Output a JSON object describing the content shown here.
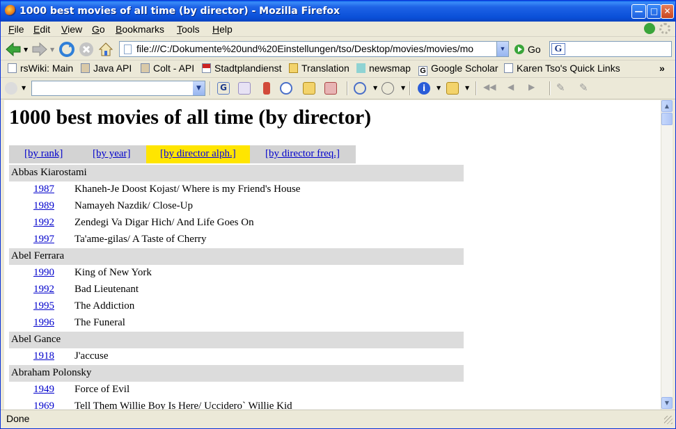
{
  "window": {
    "title": "1000 best movies of all time (by director) - Mozilla Firefox"
  },
  "menu": [
    {
      "label": "File",
      "key": "F",
      "rest": "ile"
    },
    {
      "label": "Edit",
      "key": "E",
      "rest": "dit"
    },
    {
      "label": "View",
      "key": "V",
      "rest": "iew"
    },
    {
      "label": "Go",
      "key": "G",
      "rest": "o"
    },
    {
      "label": "Bookmarks",
      "key": "B",
      "rest": "ookmarks"
    },
    {
      "label": "Tools",
      "key": "T",
      "rest": "ools"
    },
    {
      "label": "Help",
      "key": "H",
      "rest": "elp"
    }
  ],
  "nav": {
    "url": "file:///C:/Dokumente%20und%20Einstellungen/tso/Desktop/movies/movies/mo",
    "go_label": "Go"
  },
  "bookmarks": [
    {
      "label": "rsWiki: Main"
    },
    {
      "label": "Java API"
    },
    {
      "label": "Colt - API"
    },
    {
      "label": "Stadtplandienst"
    },
    {
      "label": "Translation"
    },
    {
      "label": "newsmap"
    },
    {
      "label": "Google Scholar"
    },
    {
      "label": "Karen Tso's Quick Links"
    }
  ],
  "bookmarks_more": "»",
  "page": {
    "heading": "1000 best movies of all time (by director)",
    "tabs": [
      {
        "label": "[by rank]"
      },
      {
        "label": "[by year]"
      },
      {
        "label": "[by director alph.]"
      },
      {
        "label": "[by director freq.]"
      }
    ]
  },
  "directors": [
    {
      "name": "Abbas Kiarostami",
      "films": [
        {
          "year": "1987",
          "title": "Khaneh-Je Doost Kojast/ Where is my Friend's House"
        },
        {
          "year": "1989",
          "title": "Namayeh Nazdik/ Close-Up"
        },
        {
          "year": "1992",
          "title": "Zendegi Va Digar Hich/ And Life Goes On"
        },
        {
          "year": "1997",
          "title": "Ta'ame-gilas/ A Taste of Cherry"
        }
      ]
    },
    {
      "name": "Abel Ferrara",
      "films": [
        {
          "year": "1990",
          "title": "King of New York"
        },
        {
          "year": "1992",
          "title": "Bad Lieutenant"
        },
        {
          "year": "1995",
          "title": "The Addiction"
        },
        {
          "year": "1996",
          "title": "The Funeral"
        }
      ]
    },
    {
      "name": "Abel Gance",
      "films": [
        {
          "year": "1918",
          "title": "J'accuse"
        }
      ]
    },
    {
      "name": "Abraham Polonsky",
      "films": [
        {
          "year": "1949",
          "title": "Force of Evil"
        },
        {
          "year": "1969",
          "title": "Tell Them Willie Boy Is Here/ Uccidero` Willie Kid"
        }
      ]
    }
  ],
  "status": {
    "text": "Done"
  },
  "colors": {
    "tab_highlight": "#ffe500",
    "director_row": "#dcdcdc",
    "link": "#0000cc"
  }
}
